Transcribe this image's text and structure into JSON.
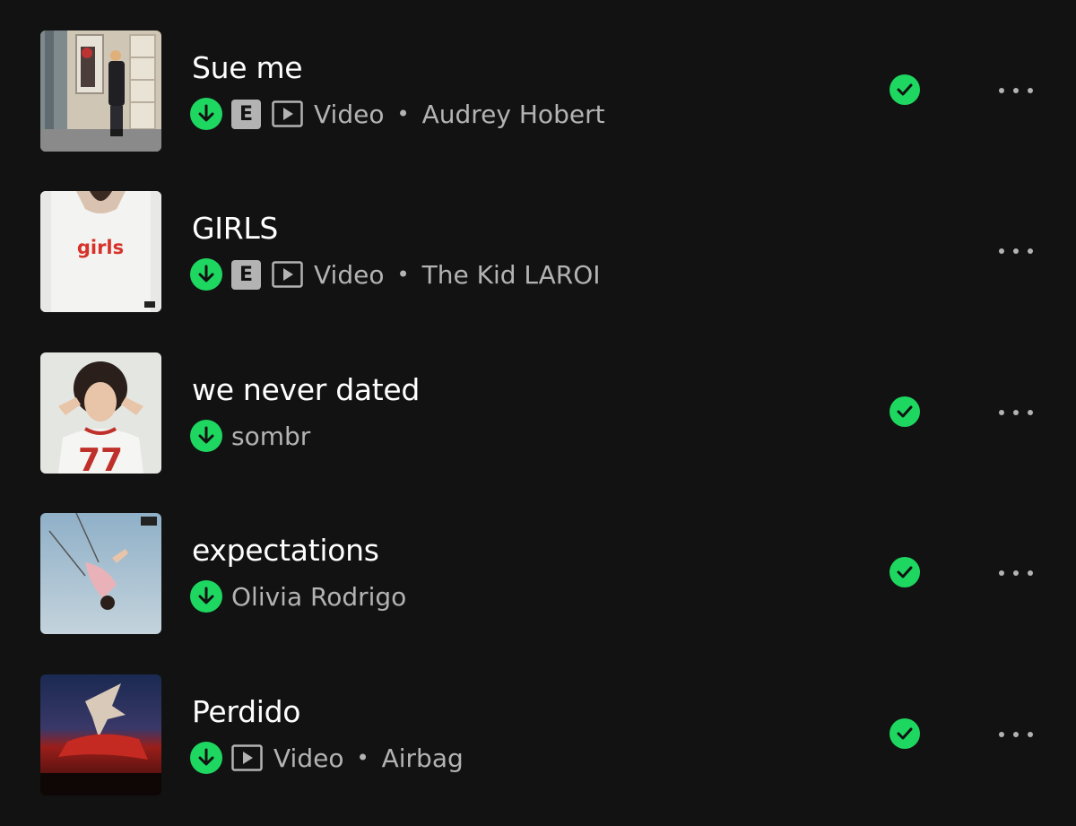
{
  "colors": {
    "background": "#121212",
    "accent_green": "#1ed760",
    "title_text": "#ffffff",
    "secondary_text": "#b3b3b3"
  },
  "tracks": [
    {
      "title": "Sue me",
      "downloaded": true,
      "explicit": true,
      "explicit_label": "E",
      "has_video": true,
      "video_label": "Video",
      "artist": "Audrey Hobert",
      "liked": true,
      "cover_icon": "album-cover-sue-me"
    },
    {
      "title": "GIRLS",
      "downloaded": true,
      "explicit": true,
      "explicit_label": "E",
      "has_video": true,
      "video_label": "Video",
      "artist": "The Kid LAROI",
      "liked": false,
      "cover_icon": "album-cover-girls",
      "cover_text": "girls"
    },
    {
      "title": "we never dated",
      "downloaded": true,
      "explicit": false,
      "has_video": false,
      "artist": "sombr",
      "liked": true,
      "cover_icon": "album-cover-we-never-dated",
      "cover_text": "77"
    },
    {
      "title": "expectations",
      "downloaded": true,
      "explicit": false,
      "has_video": false,
      "artist": "Olivia Rodrigo",
      "liked": true,
      "cover_icon": "album-cover-expectations"
    },
    {
      "title": "Perdido",
      "downloaded": true,
      "explicit": false,
      "has_video": true,
      "video_label": "Video",
      "artist": "Airbag",
      "liked": true,
      "cover_icon": "album-cover-perdido"
    }
  ]
}
